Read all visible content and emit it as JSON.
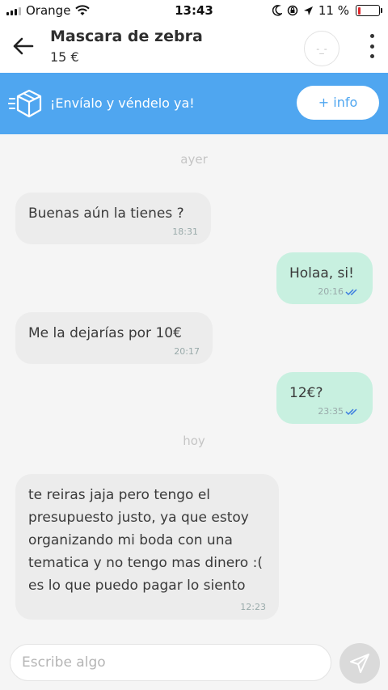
{
  "status_bar": {
    "carrier": "Orange",
    "time": "13:43",
    "battery": "11 %",
    "battery_level": 0.11
  },
  "header": {
    "title": "Mascara de zebra",
    "price": "15 €",
    "avatar_face": "-_-"
  },
  "banner": {
    "text": "¡Envíalo y véndelo ya!",
    "button_label": "+ info"
  },
  "chat": {
    "day_yesterday": "ayer",
    "day_today": "hoy",
    "messages": [
      {
        "direction": "in",
        "text": "Buenas aún la tienes ?",
        "time": "18:31"
      },
      {
        "direction": "out",
        "text": "Holaa, si!",
        "time": "20:16",
        "read": true
      },
      {
        "direction": "in",
        "text": "Me la dejarías por 10€",
        "time": "20:17"
      },
      {
        "direction": "out",
        "text": "12€?",
        "time": "23:35",
        "read": true
      },
      {
        "direction": "in",
        "text": "te reiras jaja pero tengo el presupuesto justo, ya que estoy organizando mi boda con una tematica y no tengo mas dinero :( es lo que puedo pagar lo siento",
        "time": "12:23"
      }
    ]
  },
  "composer": {
    "placeholder": "Escribe algo"
  },
  "colors": {
    "accent": "#4fa6f0",
    "outgoing_bubble": "#c8f0e0",
    "incoming_bubble": "#ececec",
    "read_ticks": "#3b7de0"
  }
}
